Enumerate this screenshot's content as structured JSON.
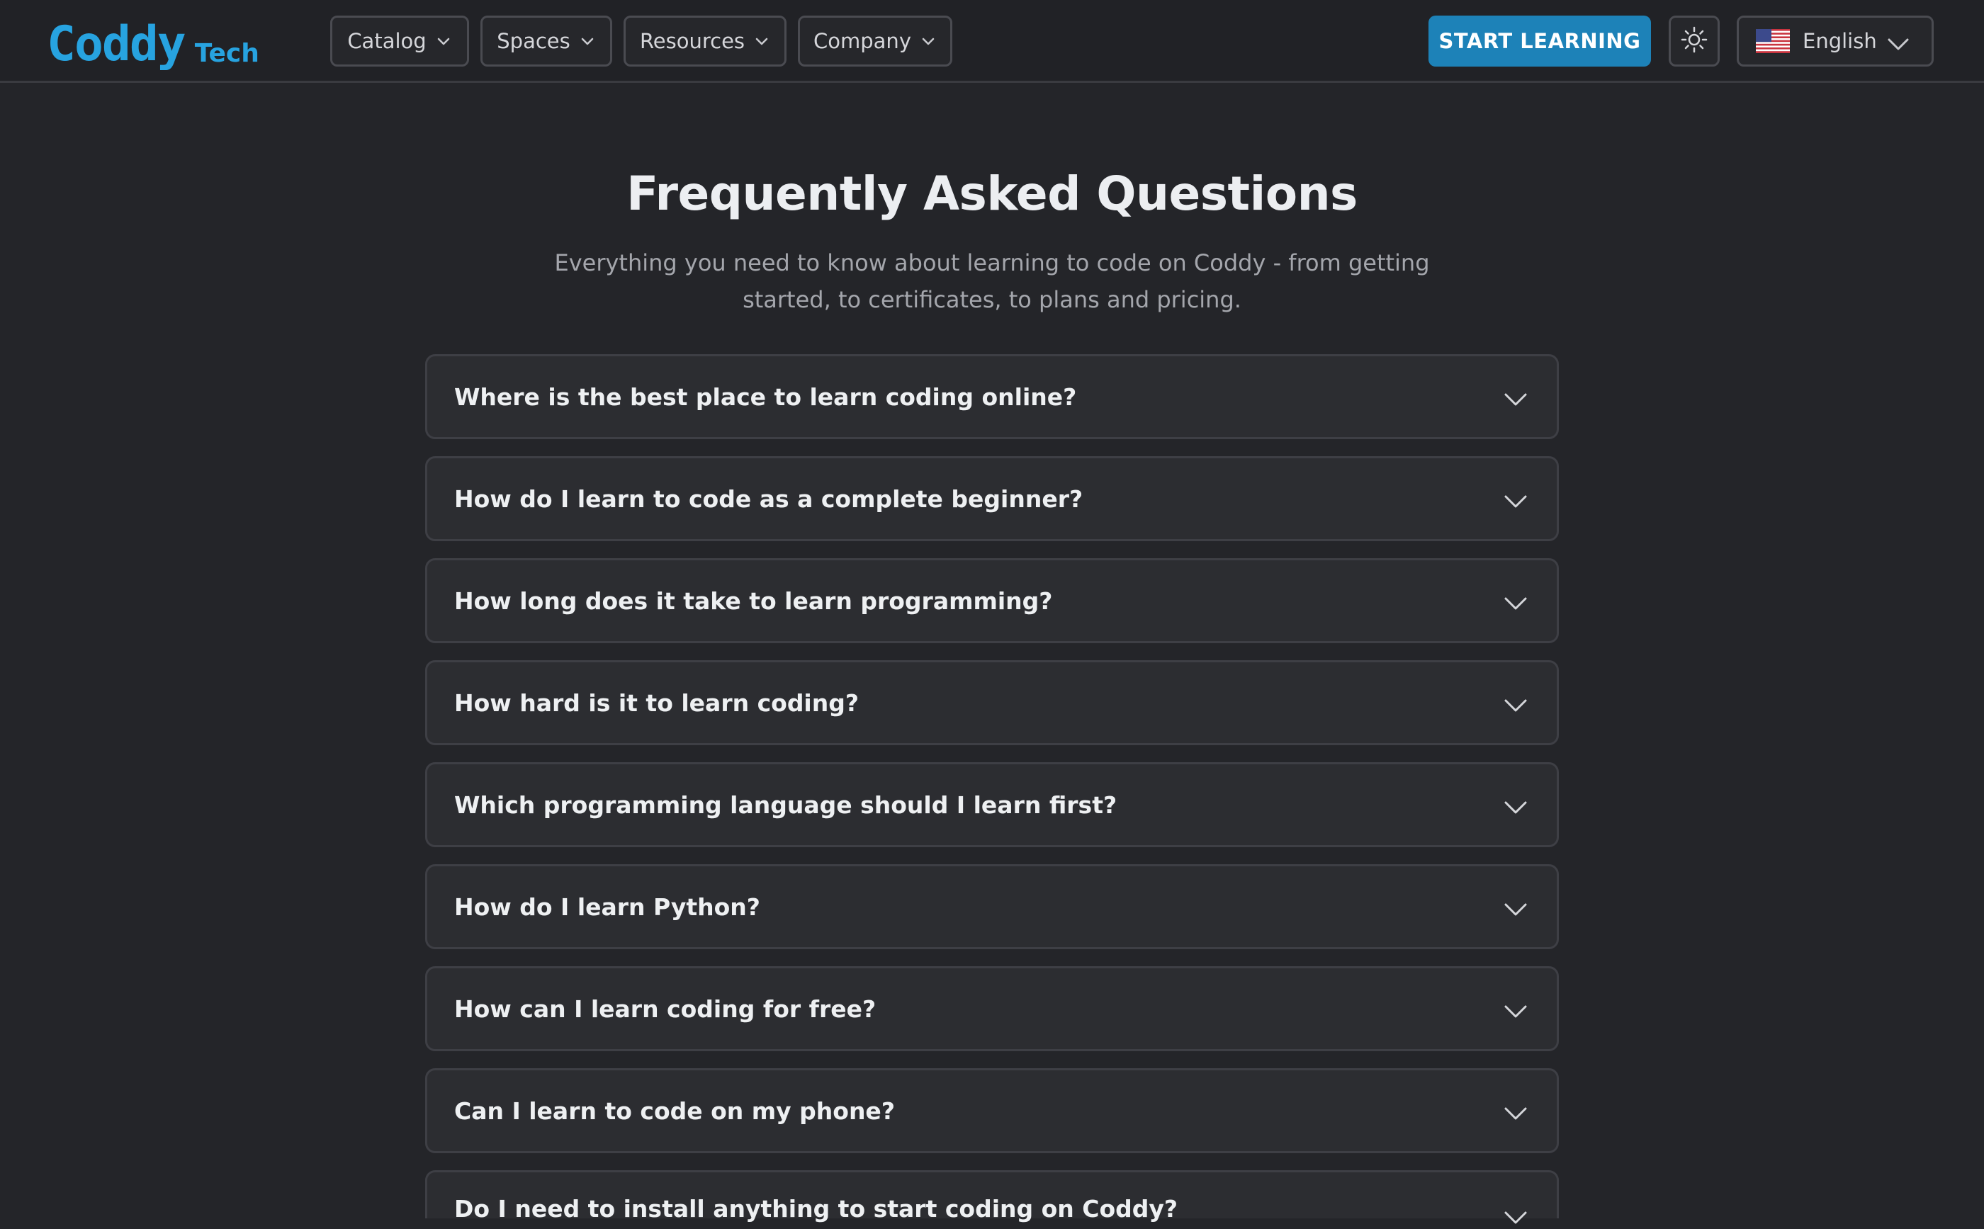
{
  "header": {
    "logo_main": "Coddy",
    "logo_sub": "Tech",
    "nav": [
      {
        "label": "Catalog"
      },
      {
        "label": "Spaces"
      },
      {
        "label": "Resources"
      },
      {
        "label": "Company"
      }
    ],
    "cta_label": "START LEARNING",
    "language": "English"
  },
  "colors": {
    "accent": "#27a3e0",
    "cta": "#1d82b8",
    "background": "#242529",
    "card": "#2c2d31"
  },
  "icons": {
    "theme": "sun-icon",
    "flag": "us-flag-icon",
    "chevron": "chevron-down-icon"
  },
  "faq": {
    "title": "Frequently Asked Questions",
    "subtitle": "Everything you need to know about learning to code on Coddy - from getting started, to certificates, to plans and pricing.",
    "items": [
      {
        "question": "Where is the best place to learn coding online?"
      },
      {
        "question": "How do I learn to code as a complete beginner?"
      },
      {
        "question": "How long does it take to learn programming?"
      },
      {
        "question": "How hard is it to learn coding?"
      },
      {
        "question": "Which programming language should I learn first?"
      },
      {
        "question": "How do I learn Python?"
      },
      {
        "question": "How can I learn coding for free?"
      },
      {
        "question": "Can I learn to code on my phone?"
      },
      {
        "question": "Do I need to install anything to start coding on Coddy?"
      }
    ]
  }
}
